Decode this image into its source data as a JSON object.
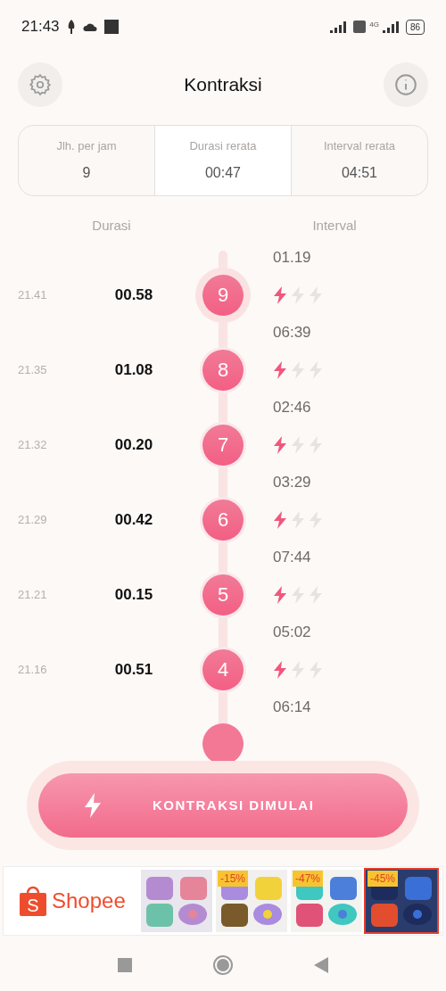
{
  "status_bar": {
    "time": "21:43",
    "battery": "86",
    "network": "4G"
  },
  "header": {
    "title": "Kontraksi"
  },
  "stats": [
    {
      "label": "Jlh. per jam",
      "value": "9"
    },
    {
      "label": "Durasi rerata",
      "value": "00:47"
    },
    {
      "label": "Interval rerata",
      "value": "04:51"
    }
  ],
  "columns": {
    "duration": "Durasi",
    "interval": "Interval"
  },
  "contractions": [
    {
      "interval": "01.19",
      "time": "21.41",
      "duration": "00.58",
      "number": "9",
      "highlighted": true,
      "stars": 1
    },
    {
      "interval": "06:39",
      "time": "21.35",
      "duration": "01.08",
      "number": "8",
      "highlighted": false,
      "stars": 1
    },
    {
      "interval": "02:46",
      "time": "21.32",
      "duration": "00.20",
      "number": "7",
      "highlighted": false,
      "stars": 1
    },
    {
      "interval": "03:29",
      "time": "21.29",
      "duration": "00.42",
      "number": "6",
      "highlighted": false,
      "stars": 1
    },
    {
      "interval": "07:44",
      "time": "21.21",
      "duration": "00.15",
      "number": "5",
      "highlighted": false,
      "stars": 1
    },
    {
      "interval": "05:02",
      "time": "21.16",
      "duration": "00.51",
      "number": "4",
      "highlighted": false,
      "stars": 1
    }
  ],
  "last_interval": "06:14",
  "start_button": {
    "label": "KONTRAKSI DIMULAI"
  },
  "ad": {
    "logo_letter": "S",
    "brand": "Shopee",
    "products": [
      {
        "kind": "picture"
      },
      {
        "kind": "picture",
        "badge": "-15%"
      },
      {
        "kind": "picture",
        "badge": "-47%"
      },
      {
        "kind": "picture",
        "badge": "-45%",
        "selected": true
      }
    ]
  }
}
